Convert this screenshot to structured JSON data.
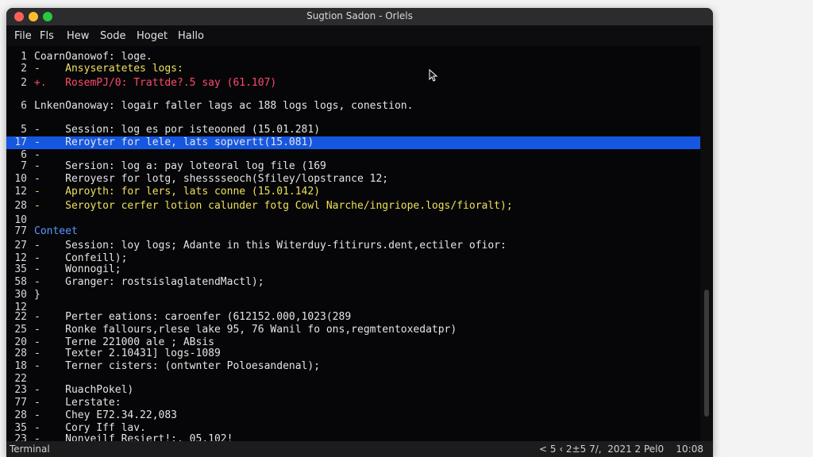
{
  "window": {
    "title": "Sugtion Sadon - Orlels"
  },
  "menu": [
    "File",
    "Fls",
    "Hew",
    "Sode",
    "Hoget",
    "Hallo"
  ],
  "editor": {
    "lines": [
      {
        "num": "1",
        "text": "CoarnOanowof: loge.",
        "style": "normal"
      },
      {
        "num": "2",
        "text": "-    Ansyseratetes logs:",
        "style": "yellow"
      },
      {
        "num": "2",
        "text": "+.   RosemPJ/0: Trattde?.5 say (61.107)",
        "style": "red"
      },
      {
        "num": "",
        "text": "",
        "style": "normal"
      },
      {
        "num": "6",
        "text": "LnkenOanoway: logair faller lags ac 188 logs logs, conestion.",
        "style": "normal"
      },
      {
        "num": "",
        "text": "",
        "style": "normal"
      },
      {
        "num": "5",
        "text": "-    Session: log es por isteooned (15.01.281)",
        "style": "normal"
      },
      {
        "num": "17",
        "text": "-    Reroyter for lele, lats sopvertt(15.081)",
        "style": "highlight"
      },
      {
        "num": "6",
        "text": "-",
        "style": "normal"
      },
      {
        "num": "7",
        "text": "-    Sersion: log a: pay loteoral log file (169",
        "style": "normal"
      },
      {
        "num": "10",
        "text": "-    Reroyesr for lotg, shesssseoch(Sfiley/lopstrance 12;",
        "style": "normal"
      },
      {
        "num": "12",
        "text": "-    Aproyth: for lers, lats conne (15.01.142)",
        "style": "yellow"
      },
      {
        "num": "28",
        "text": "-    Seroytor cerfer lotion calunder fotg Cowl Narche/ingriope.logs/fioralt);",
        "style": "yellow"
      },
      {
        "num": "10",
        "text": "",
        "style": "normal"
      },
      {
        "num": "77",
        "text": "Conteet",
        "style": "blue"
      },
      {
        "num": "27",
        "text": "-    Session: loy logs; Adante in this Witerduy-fitirurs.dent,ectiler ofior:",
        "style": "normal"
      },
      {
        "num": "12",
        "text": "-    Confeill);",
        "style": "normal"
      },
      {
        "num": "35",
        "text": "-    Wonnogil;",
        "style": "normal"
      },
      {
        "num": "58",
        "text": "-    Granger: rostsislaglatendMactl);",
        "style": "normal"
      },
      {
        "num": "30",
        "text": "}",
        "style": "normal"
      },
      {
        "num": "12",
        "text": "",
        "style": "normal"
      },
      {
        "num": "22",
        "text": "-    Perter eations: caroenfer (612152.000,1023(289",
        "style": "normal"
      },
      {
        "num": "25",
        "text": "-    Ronke fallours,rlese lake 95, 76 Wanil fo ons,regmtentoxedatpr)",
        "style": "normal"
      },
      {
        "num": "20",
        "text": "-    Terne 221000 ale ; ABsis",
        "style": "normal"
      },
      {
        "num": "28",
        "text": "-    Texter 2.10431] logs-1089",
        "style": "normal"
      },
      {
        "num": "18",
        "text": "-    Terner cisters: (ontwnter Poloesandenal);",
        "style": "normal"
      },
      {
        "num": "22",
        "text": "",
        "style": "normal"
      },
      {
        "num": "23",
        "text": "-    RuachPokel)",
        "style": "normal"
      },
      {
        "num": "77",
        "text": "-    Lerstate:",
        "style": "normal"
      },
      {
        "num": "28",
        "text": "-    Chey E72.34.22,083",
        "style": "normal"
      },
      {
        "num": "35",
        "text": "-    Cory Iff lav.",
        "style": "normal"
      },
      {
        "num": "23",
        "text": "-    Nonyeilf Resiert!:, 05.102!",
        "style": "normal"
      }
    ]
  },
  "statusbar": {
    "left": "Terminal",
    "right": "< 5 ‹ 2±5 7/,  2021 2 Pel0    10:08"
  },
  "colors": {
    "highlight": "#1557e0",
    "yellow": "#ede05a",
    "red": "#ff4a6e",
    "blue": "#5c97ff"
  }
}
